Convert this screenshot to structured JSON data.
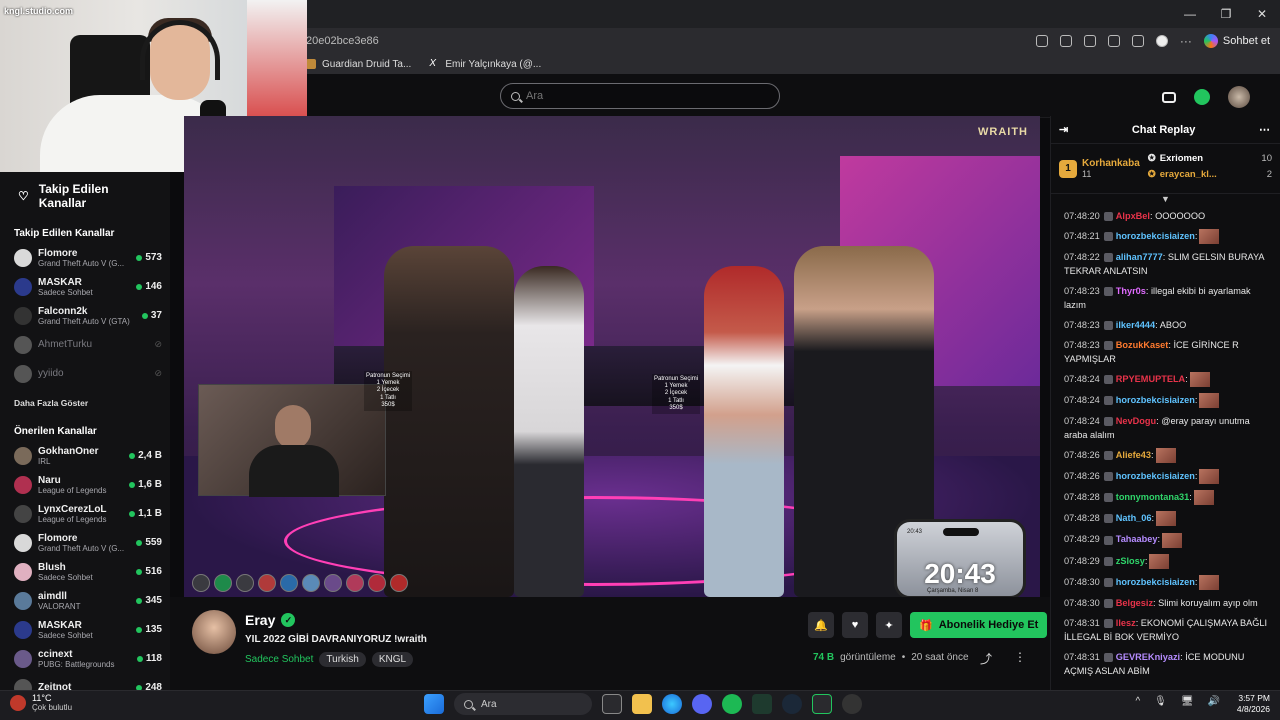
{
  "browser": {
    "url": "20e02bce3e86",
    "copilot_label": "Sohbet et",
    "bookmarks": [
      "Guardian Druid Ta...",
      "Emir Yalçınkaya (@..."
    ]
  },
  "webcam": {
    "watermark": "kngl.studio.com"
  },
  "search": {
    "placeholder": "Ara"
  },
  "sidebar": {
    "title": "Takip Edilen Kanallar",
    "followed_header": "Takip Edilen Kanallar",
    "followed": [
      {
        "name": "Flomore",
        "game": "Grand Theft Auto V (G...",
        "viewers": "573",
        "color": "#d9d9d9"
      },
      {
        "name": "MASKAR",
        "game": "Sadece Sohbet",
        "viewers": "146",
        "color": "#2b3a8c"
      },
      {
        "name": "Falconn2k",
        "game": "Grand Theft Auto V (GTA)",
        "viewers": "37",
        "color": "#333"
      },
      {
        "name": "AhmetTurku",
        "game": "",
        "viewers": "",
        "color": "#555"
      },
      {
        "name": "yyiido",
        "game": "",
        "viewers": "",
        "color": "#555"
      }
    ],
    "show_more": "Daha Fazla Göster",
    "recommended_header": "Önerilen Kanallar",
    "recommended": [
      {
        "name": "GokhanOner",
        "game": "IRL",
        "viewers": "2,4 B",
        "color": "#7a6a5a"
      },
      {
        "name": "Naru",
        "game": "League of Legends",
        "viewers": "1,6 B",
        "color": "#b03050"
      },
      {
        "name": "LynxCerezLoL",
        "game": "League of Legends",
        "viewers": "1,1 B",
        "color": "#444"
      },
      {
        "name": "Flomore",
        "game": "Grand Theft Auto V (G...",
        "viewers": "559",
        "color": "#d9d9d9"
      },
      {
        "name": "Blush",
        "game": "Sadece Sohbet",
        "viewers": "516",
        "color": "#e0b0c0"
      },
      {
        "name": "aimdll",
        "game": "VALORANT",
        "viewers": "345",
        "color": "#5a7a9a"
      },
      {
        "name": "MASKAR",
        "game": "Sadece Sohbet",
        "viewers": "135",
        "color": "#2b3a8c"
      },
      {
        "name": "ccinext",
        "game": "PUBG: Battlegrounds",
        "viewers": "118",
        "color": "#6a5a8a"
      },
      {
        "name": "Zeitnot",
        "game": "",
        "viewers": "248",
        "color": "#555"
      }
    ]
  },
  "video": {
    "overlay_brand": "WRAITH",
    "phone_time_small": "20:43",
    "phone_clock": "20:43",
    "phone_date": "Çarşamba, Nisan 8",
    "menu_labels": [
      "Patronun Seçimi\n1 Yemek\n2 İçecek\n1 Tatlı\n350$",
      "Patronun Seçimi\n1 Yemek\n2 İçecek\n1 Tatlı\n350$"
    ]
  },
  "stream": {
    "streamer": "Eray",
    "title": "YIL 2022 GİBİ DAVRANIYORUZ  !wraith",
    "category": "Sadece Sohbet",
    "tags": [
      "Turkish",
      "KNGL"
    ],
    "gift_button": "Abonelik Hediye Et",
    "viewers": "74 B",
    "viewers_label": "görüntüleme",
    "time_ago": "20 saat önce"
  },
  "chat": {
    "title": "Chat Replay",
    "top_gifter": {
      "rank": "1",
      "name": "Korhankaba",
      "count": "11"
    },
    "gifters": [
      {
        "name": "Exriomen",
        "count": "10"
      },
      {
        "name": "eraycan_kl...",
        "count": "2"
      }
    ],
    "messages": [
      {
        "time": "07:48:20",
        "user": "AlpxBel",
        "color": "#e8334a",
        "text": ": OOOOOOO",
        "emote": false
      },
      {
        "time": "07:48:21",
        "user": "horozbekcisiaizen",
        "color": "#5fc3ff",
        "text": ":",
        "emote": true
      },
      {
        "time": "07:48:22",
        "user": "alihan7777",
        "color": "#5fc3ff",
        "text": ": SLIM GELSIN BURAYA TEKRAR ANLATSIN",
        "emote": false
      },
      {
        "time": "07:48:23",
        "user": "Thyr0s",
        "color": "#e06bff",
        "text": ": illegal ekibi bi ayarlamak lazım",
        "emote": false
      },
      {
        "time": "07:48:23",
        "user": "ilker4444",
        "color": "#5fc3ff",
        "text": ": ABOO",
        "emote": false
      },
      {
        "time": "07:48:23",
        "user": "BozukKaset",
        "color": "#ff7a2f",
        "text": ": İCE GİRİNCE R YAPMIŞLAR",
        "emote": false
      },
      {
        "time": "07:48:24",
        "user": "RPYEMUPTELA",
        "color": "#e8334a",
        "text": ":",
        "emote": true
      },
      {
        "time": "07:48:24",
        "user": "horozbekcisiaizen",
        "color": "#5fc3ff",
        "text": ":",
        "emote": true
      },
      {
        "time": "07:48:24",
        "user": "NevDogu",
        "color": "#e8334a",
        "text": ": @eray parayı unutma araba alalım",
        "emote": false
      },
      {
        "time": "07:48:26",
        "user": "Aliefe43",
        "color": "#e5a93c",
        "text": ":",
        "emote": true
      },
      {
        "time": "07:48:26",
        "user": "horozbekcisiaizen",
        "color": "#5fc3ff",
        "text": ":",
        "emote": true
      },
      {
        "time": "07:48:28",
        "user": "tonnymontana31",
        "color": "#2fd46a",
        "text": ":",
        "emote": true
      },
      {
        "time": "07:48:28",
        "user": "Nath_06",
        "color": "#5fc3ff",
        "text": ":",
        "emote": true
      },
      {
        "time": "07:48:29",
        "user": "Tahaabey",
        "color": "#b58cff",
        "text": ":",
        "emote": true
      },
      {
        "time": "07:48:29",
        "user": "zSlosy",
        "color": "#2fd46a",
        "text": ":",
        "emote": true
      },
      {
        "time": "07:48:30",
        "user": "horozbekcisiaizen",
        "color": "#5fc3ff",
        "text": ":",
        "emote": true
      },
      {
        "time": "07:48:30",
        "user": "Belgesiz",
        "color": "#e8334a",
        "text": ": Slimi koruyalım ayıp olm",
        "emote": false
      },
      {
        "time": "07:48:31",
        "user": "llesz",
        "color": "#e8334a",
        "text": ": EKONOMİ ÇALIŞMAYA BAĞLI İLLEGAL Bİ BOK VERMİYO",
        "emote": false
      },
      {
        "time": "07:48:31",
        "user": "GEVREKniyazi",
        "color": "#b58cff",
        "text": ": İCE MODUNU AÇMIŞ ASLAN ABİM",
        "emote": false
      }
    ]
  },
  "taskbar": {
    "temp": "11°C",
    "weather": "Çok bulutlu",
    "search": "Ara",
    "time": "3:57 PM",
    "date": "4/8/2026"
  },
  "colors": {
    "accent": "#22c55e",
    "background": "#0e0e10"
  }
}
